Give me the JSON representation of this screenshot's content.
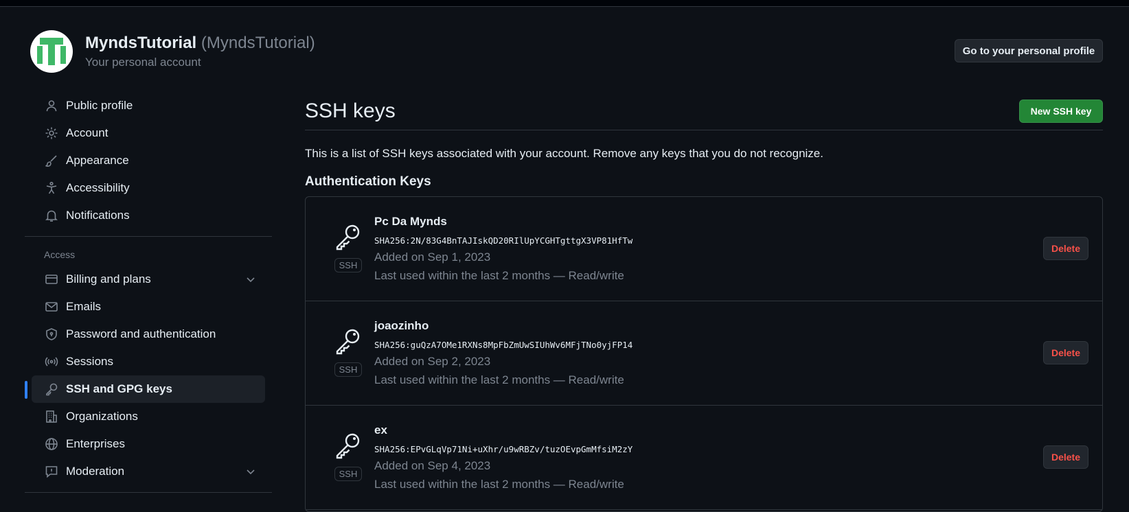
{
  "header": {
    "account_name": "MyndsTutorial",
    "account_login": "(MyndsTutorial)",
    "account_subtitle": "Your personal account",
    "profile_button": "Go to your personal profile"
  },
  "sidebar": {
    "items": [
      {
        "label": "Public profile",
        "icon": "person-icon"
      },
      {
        "label": "Account",
        "icon": "gear-icon"
      },
      {
        "label": "Appearance",
        "icon": "paintbrush-icon"
      },
      {
        "label": "Accessibility",
        "icon": "accessibility-icon"
      },
      {
        "label": "Notifications",
        "icon": "bell-icon"
      }
    ],
    "access_label": "Access",
    "access_items": [
      {
        "label": "Billing and plans",
        "icon": "credit-card-icon"
      },
      {
        "label": "Emails",
        "icon": "mail-icon"
      },
      {
        "label": "Password and authentication",
        "icon": "shield-lock-icon"
      },
      {
        "label": "Sessions",
        "icon": "broadcast-icon"
      },
      {
        "label": "SSH and GPG keys",
        "icon": "key-icon"
      },
      {
        "label": "Organizations",
        "icon": "organization-icon"
      },
      {
        "label": "Enterprises",
        "icon": "globe-icon"
      },
      {
        "label": "Moderation",
        "icon": "report-icon"
      }
    ]
  },
  "main": {
    "title": "SSH keys",
    "new_button": "New SSH key",
    "description": "This is a list of SSH keys associated with your account. Remove any keys that you do not recognize.",
    "section_title": "Authentication Keys",
    "badge": "SSH",
    "delete_label": "Delete",
    "keys": [
      {
        "title": "Pc Da Mynds",
        "fingerprint": "SHA256:2N/83G4BnTAJIskQD20RIlUpYCGHTgttgX3VP81HfTw",
        "added": "Added on Sep 1, 2023",
        "last_used": "Last used within the last 2 months — Read/write"
      },
      {
        "title": "joaozinho",
        "fingerprint": "SHA256:guQzA7OMe1RXNs8MpFbZmUwSIUhWv6MFjTNo0yjFP14",
        "added": "Added on Sep 2, 2023",
        "last_used": "Last used within the last 2 months — Read/write"
      },
      {
        "title": "ex",
        "fingerprint": "SHA256:EPvGLqVp71Ni+uXhr/u9wRBZv/tuzOEvpGmMfsiM2zY",
        "added": "Added on Sep 4, 2023",
        "last_used": "Last used within the last 2 months — Read/write"
      }
    ]
  },
  "colors": {
    "background": "#0d1117",
    "accent": "#2f81f7",
    "primary_button": "#238636",
    "danger": "#f85149",
    "avatar_green": "#3fb867"
  }
}
